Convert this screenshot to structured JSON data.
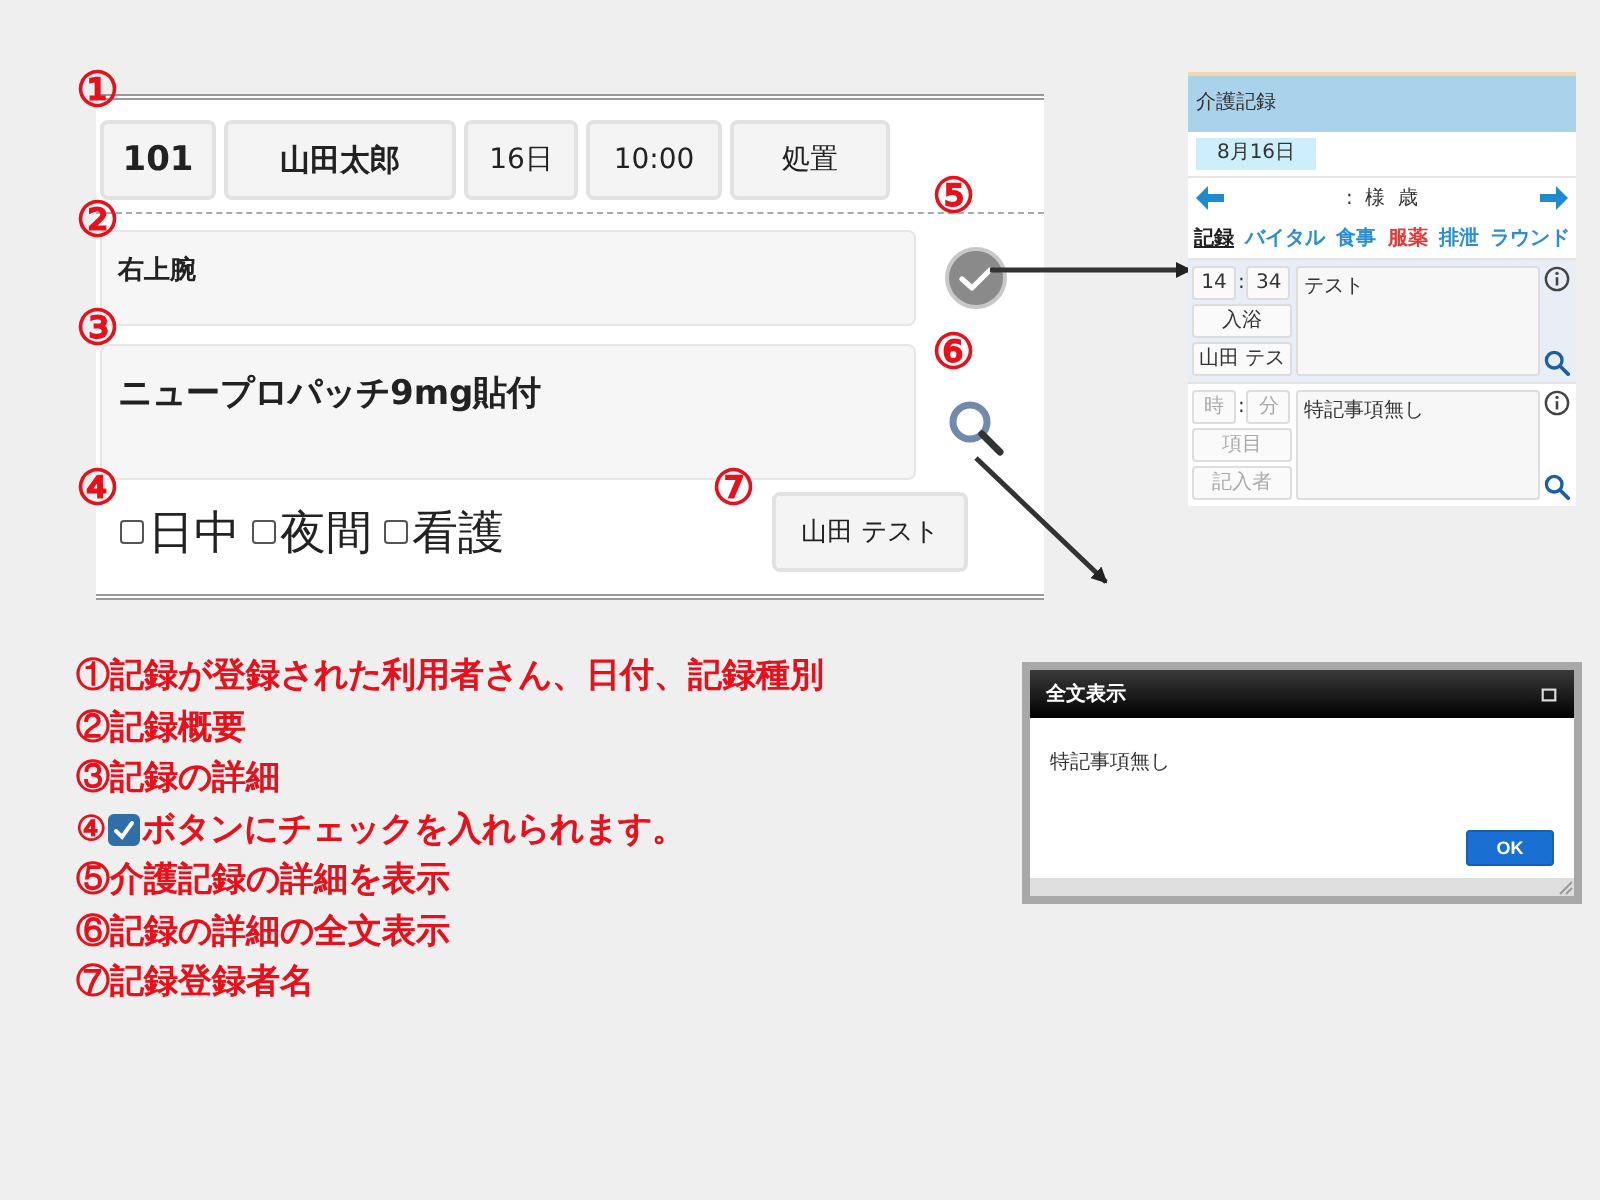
{
  "record_form": {
    "header_buttons": [
      {
        "text": "101",
        "bold": true
      },
      {
        "text": "山田太郎",
        "bold": true
      },
      {
        "text": "16日",
        "bold": false
      },
      {
        "text": "10:00",
        "bold": false
      },
      {
        "text": "処置",
        "bold": false
      }
    ],
    "summary": "右上腕",
    "detail": "ニュープロパッチ9mg貼付",
    "checkboxes": [
      {
        "label": "日中",
        "checked": false
      },
      {
        "label": "夜間",
        "checked": false
      },
      {
        "label": "看護",
        "checked": false
      }
    ],
    "author_button": "山田 テスト"
  },
  "callouts": [
    "①",
    "②",
    "③",
    "④",
    "⑤",
    "⑥",
    "⑦"
  ],
  "phone_screen": {
    "title": "介護記録",
    "date_tab": "8月16日",
    "name_separator": ":",
    "name_suffix": "様",
    "age_suffix": "歳",
    "tabs": [
      {
        "label": "記録",
        "selected": true,
        "color": "#222222"
      },
      {
        "label": "バイタル",
        "selected": false,
        "color": "#2b8fd6"
      },
      {
        "label": "食事",
        "selected": false,
        "color": "#2b8fd6"
      },
      {
        "label": "服薬",
        "selected": false,
        "color": "#e53935"
      },
      {
        "label": "排泄",
        "selected": false,
        "color": "#2b8fd6"
      },
      {
        "label": "ラウンド",
        "selected": false,
        "color": "#2b8fd6"
      }
    ],
    "records": [
      {
        "selected": true,
        "separator": ":",
        "hour": {
          "value": "14"
        },
        "minute": {
          "value": "34"
        },
        "item": {
          "value": "入浴"
        },
        "author": {
          "value": "山田 テス"
        },
        "note": "テスト"
      },
      {
        "selected": false,
        "separator": ":",
        "hour": {
          "placeholder": "時"
        },
        "minute": {
          "placeholder": "分"
        },
        "item": {
          "placeholder": "項目"
        },
        "author": {
          "placeholder": "記入者"
        },
        "note": "特記事項無し"
      }
    ]
  },
  "dialog": {
    "title": "全文表示",
    "body": "特記事項無し",
    "ok_button": "OK"
  },
  "legend": [
    {
      "kind": "text",
      "text": "①記録が登録された利用者さん、日付、記録種別"
    },
    {
      "kind": "text",
      "text": "②記録概要"
    },
    {
      "kind": "text",
      "text": "③記録の詳細"
    },
    {
      "kind": "checkbox",
      "prefix": "④",
      "checked": true,
      "text": "ボタンにチェックを入れられます。"
    },
    {
      "kind": "text",
      "text": "⑤介護記録の詳細を表示"
    },
    {
      "kind": "text",
      "text": "⑥記録の詳細の全文表示"
    },
    {
      "kind": "text",
      "text": "⑦記録登録者名"
    }
  ]
}
